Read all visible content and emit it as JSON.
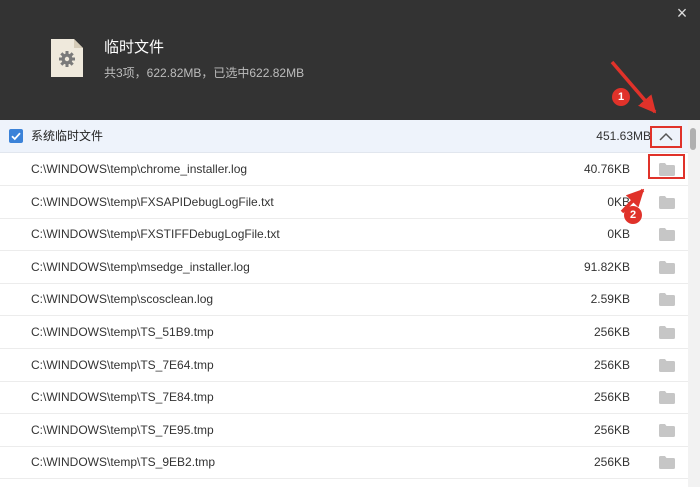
{
  "header": {
    "title": "临时文件",
    "summary": "共3项，622.82MB，已选中622.82MB",
    "close_glyph": "×"
  },
  "group": {
    "label": "系统临时文件",
    "size": "451.63MB",
    "checked": true
  },
  "files": [
    {
      "path": "C:\\WINDOWS\\temp\\chrome_installer.log",
      "size": "40.76KB"
    },
    {
      "path": "C:\\WINDOWS\\temp\\FXSAPIDebugLogFile.txt",
      "size": "0KB"
    },
    {
      "path": "C:\\WINDOWS\\temp\\FXSTIFFDebugLogFile.txt",
      "size": "0KB"
    },
    {
      "path": "C:\\WINDOWS\\temp\\msedge_installer.log",
      "size": "91.82KB"
    },
    {
      "path": "C:\\WINDOWS\\temp\\scosclean.log",
      "size": "2.59KB"
    },
    {
      "path": "C:\\WINDOWS\\temp\\TS_51B9.tmp",
      "size": "256KB"
    },
    {
      "path": "C:\\WINDOWS\\temp\\TS_7E64.tmp",
      "size": "256KB"
    },
    {
      "path": "C:\\WINDOWS\\temp\\TS_7E84.tmp",
      "size": "256KB"
    },
    {
      "path": "C:\\WINDOWS\\temp\\TS_7E95.tmp",
      "size": "256KB"
    },
    {
      "path": "C:\\WINDOWS\\temp\\TS_9EB2.tmp",
      "size": "256KB"
    }
  ],
  "annotations": {
    "step1": "1",
    "step2": "2",
    "color": "#e0322a"
  },
  "colors": {
    "header_bg": "#333333",
    "accent": "#3b82d8",
    "group_bg": "#eef3fb",
    "folder_icon": "#c6c6c6"
  },
  "icons": {
    "close": "close-icon",
    "file": "settings-file-icon",
    "checkbox": "checkbox-checked-icon",
    "collapse": "chevron-up-icon",
    "open_folder": "folder-icon"
  }
}
